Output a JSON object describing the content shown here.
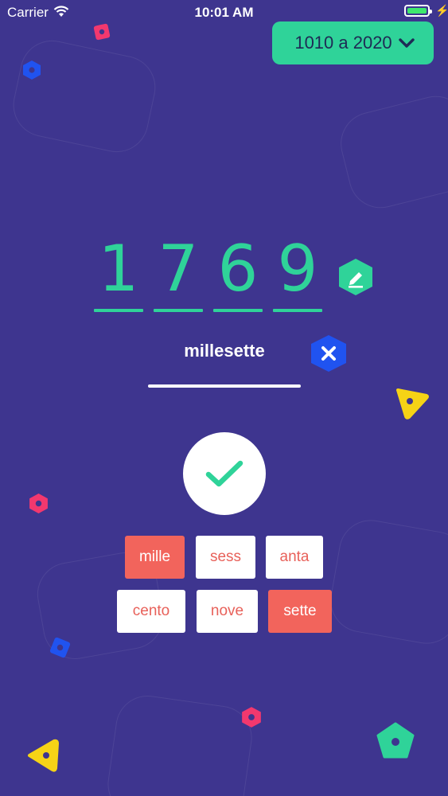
{
  "status_bar": {
    "carrier": "Carrier",
    "time": "10:01 AM"
  },
  "range": {
    "label": "1010 a 2020"
  },
  "number": {
    "digits": [
      "1",
      "7",
      "6",
      "9"
    ]
  },
  "answer": {
    "text": "millesette"
  },
  "tiles": [
    {
      "label": "mille",
      "selected": true
    },
    {
      "label": "sess",
      "selected": false
    },
    {
      "label": "anta",
      "selected": false
    },
    {
      "label": "cento",
      "selected": false
    },
    {
      "label": "nove",
      "selected": false
    },
    {
      "label": "sette",
      "selected": true
    }
  ],
  "colors": {
    "background": "#3e358f",
    "accent_green": "#2fd399",
    "accent_blue": "#2053f0",
    "tile_selected": "#f2645c",
    "tile_text": "#e8615a",
    "yellow": "#f6d316",
    "pink": "#f2386e",
    "battery": "#3ee86d"
  },
  "icons": {
    "range_chevron": "chevron-down-icon",
    "edit": "pencil-icon",
    "clear": "close-icon",
    "check": "checkmark-icon"
  }
}
